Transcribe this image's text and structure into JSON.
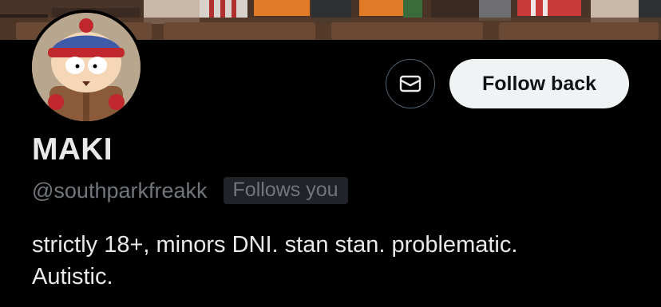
{
  "profile": {
    "display_name": "MAKI",
    "handle": "@southparkfreakk",
    "follows_you_badge": "Follows you",
    "bio_line1": "strictly 18+, minors DNI. stan stan. problematic.",
    "bio_line2": "Autistic."
  },
  "actions": {
    "follow_back_label": "Follow back",
    "message_icon": "envelope-icon"
  },
  "colors": {
    "background": "#000000",
    "primary_text": "#e7e9ea",
    "secondary_text": "#71767b",
    "follow_button_bg": "#eff3f4",
    "follow_button_text": "#0f1419",
    "badge_bg": "#202327",
    "icon_border": "#536471"
  }
}
